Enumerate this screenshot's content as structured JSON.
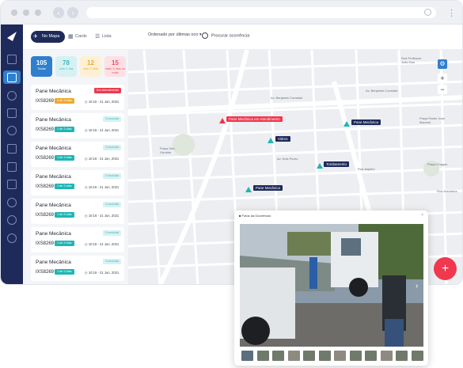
{
  "topbar": {
    "tabs": [
      {
        "label": "No Mapa",
        "icon": "map-icon",
        "active": true
      },
      {
        "label": "Cards",
        "icon": "grid-icon",
        "active": false
      },
      {
        "label": "Lista",
        "icon": "list-icon",
        "active": false
      }
    ],
    "sort_label": "Ordenado por últimas oco",
    "search_placeholder": "Procurar ocorrência"
  },
  "stats": [
    {
      "num": "105",
      "label": "Todas",
      "bg": "#2f7fcf",
      "fg": "#ffffff"
    },
    {
      "num": "78",
      "label": "com 1 dia",
      "bg": "#d7f1f2",
      "fg": "#3bb8be"
    },
    {
      "num": "12",
      "label": "com 2 dias",
      "bg": "#fdf0d5",
      "fg": "#f0a830"
    },
    {
      "num": "15",
      "label": "mais 3 dias ou mais",
      "bg": "#fde0e4",
      "fg": "#ef4e66"
    }
  ],
  "cards": [
    {
      "title": "Pane Mecânica",
      "plate": "IXS8269",
      "badge": "1 de 3 dias",
      "badge_color": "#f0a830",
      "time": "10:16 - 21 Jun, 2021",
      "status": "Em Atendimento",
      "status_bg": "#f0384f",
      "status_fg": "#ffffff"
    },
    {
      "title": "Pane Mecânica",
      "plate": "IXS8269",
      "badge": "1 de 3 dias",
      "badge_color": "#1fb5b5",
      "time": "10:16 - 21 Jun, 2021",
      "status": "Concluída",
      "status_bg": "#d7f1f2",
      "status_fg": "#3bb8be"
    },
    {
      "title": "Pane Mecânica",
      "plate": "IXS8269",
      "badge": "1 de 3 dias",
      "badge_color": "#1fb5b5",
      "time": "10:16 - 21 Jun, 2021",
      "status": "Concluída",
      "status_bg": "#d7f1f2",
      "status_fg": "#3bb8be"
    },
    {
      "title": "Pane Mecânica",
      "plate": "IXS8269",
      "badge": "1 de 3 dias",
      "badge_color": "#1fb5b5",
      "time": "10:16 - 21 Jun, 2021",
      "status": "Concluída",
      "status_bg": "#d7f1f2",
      "status_fg": "#3bb8be"
    },
    {
      "title": "Pane Mecânica",
      "plate": "IXS8269",
      "badge": "1 de 3 dias",
      "badge_color": "#1fb5b5",
      "time": "10:16 - 21 Jun, 2021",
      "status": "Concluída",
      "status_bg": "#d7f1f2",
      "status_fg": "#3bb8be"
    },
    {
      "title": "Pane Mecânica",
      "plate": "IXS8269",
      "badge": "1 de 3 dias",
      "badge_color": "#1fb5b5",
      "time": "10:16 - 21 Jun, 2021",
      "status": "Concluída",
      "status_bg": "#d7f1f2",
      "status_fg": "#3bb8be"
    },
    {
      "title": "Pane Mecânica",
      "plate": "IXS8269",
      "badge": "1 de 3 dias",
      "badge_color": "#1fb5b5",
      "time": "10:16 - 21 Jun, 2021",
      "status": "Concluída",
      "status_bg": "#d7f1f2",
      "status_fg": "#3bb8be"
    }
  ],
  "map": {
    "street_labels": [
      "Av. Benjamin Constant",
      "Av. Benjamin Constant",
      "Rua Professor João Dau",
      "Praça Padre José Marconi",
      "Praça São Geraldo",
      "Av. Dois Pedro",
      "Rua Itapirim",
      "Praça Chagas",
      "Rua Arandeira"
    ],
    "markers": [
      {
        "label": "Pane Mecânica em Atendimento",
        "color": "#f0384f"
      },
      {
        "label": "Pane Mecânica",
        "color": "#1e2a5a"
      },
      {
        "label": "Vidros",
        "color": "#1e2a5a"
      },
      {
        "label": "Tombamento",
        "color": "#1e2a5a"
      },
      {
        "label": "Pane Mecânica",
        "color": "#1e2a5a"
      }
    ],
    "zoom_in": "+",
    "zoom_out": "−"
  },
  "photo": {
    "title": "Fotos da Ocorrência",
    "close": "×",
    "next": "›"
  },
  "fab": "+"
}
